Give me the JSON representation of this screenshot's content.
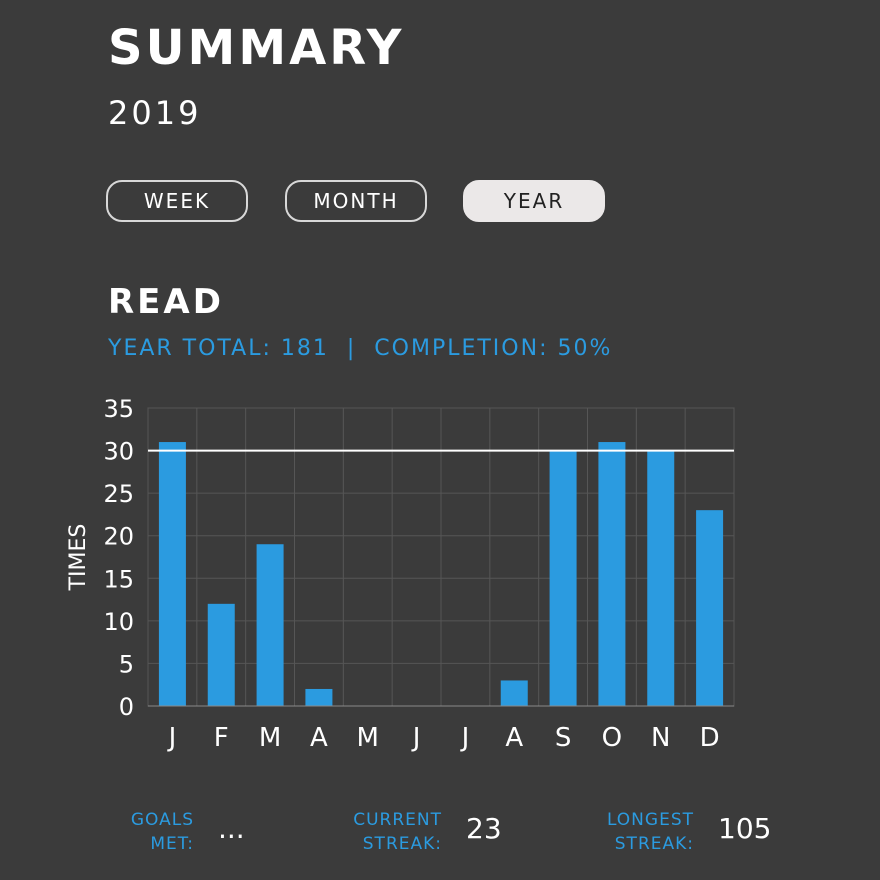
{
  "header": {
    "title": "SUMMARY",
    "year": "2019"
  },
  "range_tabs": [
    {
      "label": "WEEK",
      "active": false
    },
    {
      "label": "MONTH",
      "active": false
    },
    {
      "label": "YEAR",
      "active": true
    }
  ],
  "section": {
    "title": "READ",
    "total_label": "YEAR TOTAL: 181",
    "separator": "|",
    "completion_label": "COMPLETION: 50%"
  },
  "chart_data": {
    "type": "bar",
    "categories": [
      "J",
      "F",
      "M",
      "A",
      "M",
      "J",
      "J",
      "A",
      "S",
      "O",
      "N",
      "D"
    ],
    "values": [
      31,
      12,
      19,
      2,
      0,
      0,
      0,
      3,
      30,
      31,
      30,
      23
    ],
    "ylabel": "TIMES",
    "ylim": [
      0,
      35
    ],
    "yticks": [
      0,
      5,
      10,
      15,
      20,
      25,
      30,
      35
    ],
    "goal_line": 30,
    "grid": true,
    "bar_color": "#2b9be0",
    "goal_color": "#ffffff"
  },
  "stats": {
    "goals_met": {
      "label_line1": "GOALS",
      "label_line2": "MET:",
      "value": "..."
    },
    "current_streak": {
      "label_line1": "CURRENT",
      "label_line2": "STREAK:",
      "value": "23"
    },
    "longest_streak": {
      "label_line1": "LONGEST",
      "label_line2": "STREAK:",
      "value": "105"
    }
  },
  "colors": {
    "accent": "#2b9be0",
    "background": "#3b3b3b"
  }
}
